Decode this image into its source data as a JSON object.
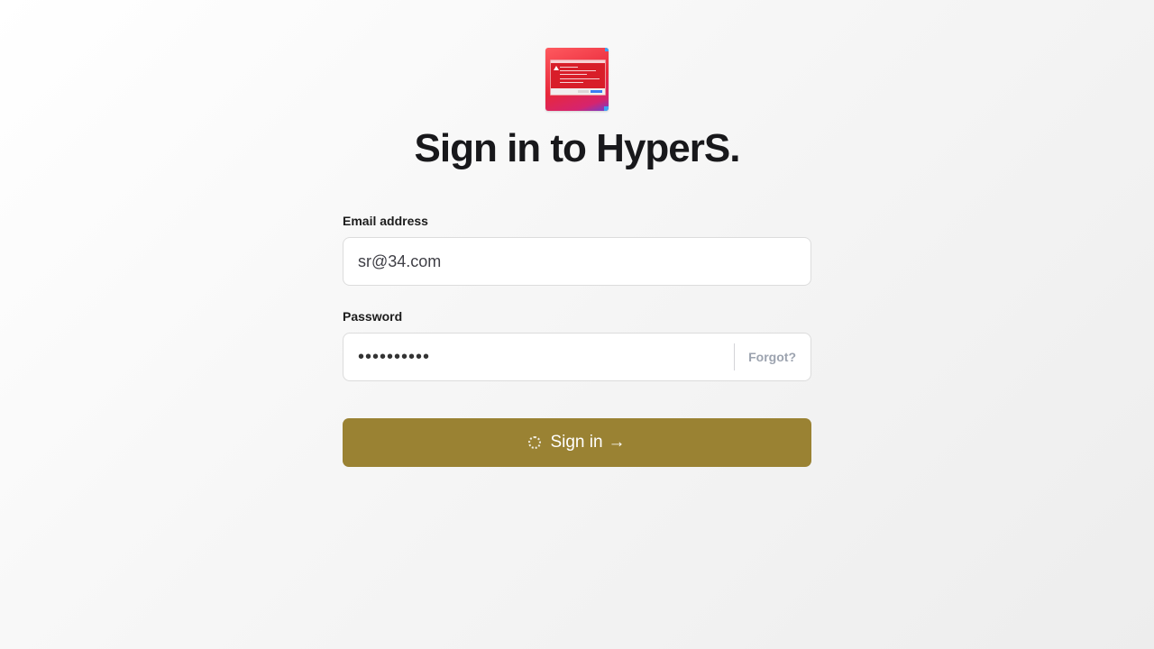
{
  "app": {
    "title": "Sign in to HyperS.",
    "logo": "hypers-logo"
  },
  "form": {
    "email": {
      "label": "Email address",
      "value": "sr@34.com"
    },
    "password": {
      "label": "Password",
      "value": "••••••••••",
      "forgot_label": "Forgot?"
    },
    "submit": {
      "label": "Sign in",
      "arrow": "→",
      "state": "loading"
    }
  },
  "colors": {
    "accent": "#9a8233",
    "muted_link": "#9ca3af",
    "logo_red": "#e8283b"
  }
}
